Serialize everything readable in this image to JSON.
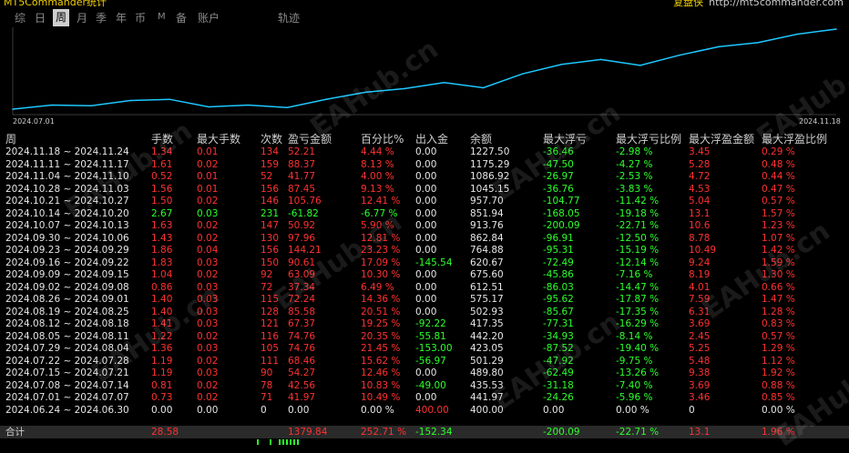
{
  "window": {
    "title": "MT5Commander统计",
    "brand_name": "复盘侠",
    "brand_url": "http://mt5commander.com"
  },
  "tabs": [
    {
      "label": "综",
      "active": false
    },
    {
      "label": "日",
      "active": false
    },
    {
      "label": "周",
      "active": true
    },
    {
      "label": "月",
      "active": false
    },
    {
      "label": "季",
      "active": false
    },
    {
      "label": "年",
      "active": false
    },
    {
      "label": "币",
      "active": false
    },
    {
      "label": "M",
      "active": false
    },
    {
      "label": "备",
      "active": false
    },
    {
      "label": "账户",
      "active": false
    },
    {
      "label": "轨迹",
      "active": false
    }
  ],
  "chart_data": {
    "type": "line",
    "x_start": "2024.07.01",
    "x_end": "2024.11.18",
    "series": [
      {
        "values": [
          400,
          441.97,
          435.53,
          489.8,
          501.29,
          423.05,
          442.2,
          417.35,
          502.93,
          575.17,
          612.51,
          675.6,
          620.67,
          764.88,
          862.84,
          913.76,
          851.94,
          957.7,
          1045.15,
          1086.92,
          1175.29,
          1227.5
        ]
      }
    ],
    "color": "#1ec8ff",
    "grid": false
  },
  "table": {
    "headers": [
      "周",
      "手数",
      "最大手数",
      "次数",
      "盈亏金额",
      "百分比%",
      "出入金",
      "余额",
      "最大浮亏",
      "最大浮亏比例",
      "最大浮盈金额",
      "最大浮盈比例"
    ],
    "rows": [
      [
        "2024.11.18 ~ 2024.11.24",
        "1.34",
        "0.01",
        "134",
        "52.21",
        "4.44 %",
        "0.00",
        "1227.50",
        "-36.46",
        "-2.98 %",
        "3.45",
        "0.29 %"
      ],
      [
        "2024.11.11 ~ 2024.11.17",
        "1.61",
        "0.02",
        "159",
        "88.37",
        "8.13 %",
        "0.00",
        "1175.29",
        "-47.50",
        "-4.27 %",
        "5.28",
        "0.48 %"
      ],
      [
        "2024.11.04 ~ 2024.11.10",
        "0.52",
        "0.01",
        "52",
        "41.77",
        "4.00 %",
        "0.00",
        "1086.92",
        "-26.97",
        "-2.53 %",
        "4.72",
        "0.44 %"
      ],
      [
        "2024.10.28 ~ 2024.11.03",
        "1.56",
        "0.01",
        "156",
        "87.45",
        "9.13 %",
        "0.00",
        "1045.15",
        "-36.76",
        "-3.83 %",
        "4.53",
        "0.47 %"
      ],
      [
        "2024.10.21 ~ 2024.10.27",
        "1.50",
        "0.02",
        "146",
        "105.76",
        "12.41 %",
        "0.00",
        "957.70",
        "-104.77",
        "-11.42 %",
        "5.04",
        "0.57 %"
      ],
      [
        "2024.10.14 ~ 2024.10.20",
        "2.67",
        "0.03",
        "231",
        "-61.82",
        "-6.77 %",
        "0.00",
        "851.94",
        "-168.05",
        "-19.18 %",
        "13.1",
        "1.57 %"
      ],
      [
        "2024.10.07 ~ 2024.10.13",
        "1.63",
        "0.02",
        "147",
        "50.92",
        "5.90 %",
        "0.00",
        "913.76",
        "-200.09",
        "-22.71 %",
        "10.6",
        "1.23 %"
      ],
      [
        "2024.09.30 ~ 2024.10.06",
        "1.43",
        "0.02",
        "130",
        "97.96",
        "12.81 %",
        "0.00",
        "862.84",
        "-96.91",
        "-12.50 %",
        "8.78",
        "1.07 %"
      ],
      [
        "2024.09.23 ~ 2024.09.29",
        "1.86",
        "0.04",
        "156",
        "144.21",
        "23.23 %",
        "0.00",
        "764.88",
        "-95.31",
        "-15.19 %",
        "10.49",
        "1.42 %"
      ],
      [
        "2024.09.16 ~ 2024.09.22",
        "1.83",
        "0.03",
        "150",
        "90.61",
        "17.09 %",
        "-145.54",
        "620.67",
        "-72.49",
        "-12.14 %",
        "9.24",
        "1.59 %"
      ],
      [
        "2024.09.09 ~ 2024.09.15",
        "1.04",
        "0.02",
        "92",
        "63.09",
        "10.30 %",
        "0.00",
        "675.60",
        "-45.86",
        "-7.16 %",
        "8.19",
        "1.30 %"
      ],
      [
        "2024.09.02 ~ 2024.09.08",
        "0.86",
        "0.03",
        "72",
        "37.34",
        "6.49 %",
        "0.00",
        "612.51",
        "-86.03",
        "-14.47 %",
        "4.01",
        "0.66 %"
      ],
      [
        "2024.08.26 ~ 2024.09.01",
        "1.40",
        "0.03",
        "115",
        "72.24",
        "14.36 %",
        "0.00",
        "575.17",
        "-95.62",
        "-17.87 %",
        "7.59",
        "1.47 %"
      ],
      [
        "2024.08.19 ~ 2024.08.25",
        "1.40",
        "0.03",
        "128",
        "85.58",
        "20.51 %",
        "0.00",
        "502.93",
        "-85.67",
        "-17.35 %",
        "6.31",
        "1.28 %"
      ],
      [
        "2024.08.12 ~ 2024.08.18",
        "1.41",
        "0.03",
        "121",
        "67.37",
        "19.25 %",
        "-92.22",
        "417.35",
        "-77.31",
        "-16.29 %",
        "3.69",
        "0.83 %"
      ],
      [
        "2024.08.05 ~ 2024.08.11",
        "1.22",
        "0.02",
        "116",
        "74.76",
        "20.35 %",
        "-55.81",
        "442.20",
        "-34.93",
        "-8.14 %",
        "2.45",
        "0.57 %"
      ],
      [
        "2024.07.29 ~ 2024.08.04",
        "1.36",
        "0.03",
        "105",
        "74.76",
        "21.45 %",
        "-153.00",
        "423.05",
        "-87.52",
        "-19.40 %",
        "5.25",
        "1.29 %"
      ],
      [
        "2024.07.22 ~ 2024.07.28",
        "1.19",
        "0.02",
        "111",
        "68.46",
        "15.62 %",
        "-56.97",
        "501.29",
        "-47.92",
        "-9.75 %",
        "5.48",
        "1.12 %"
      ],
      [
        "2024.07.15 ~ 2024.07.21",
        "1.19",
        "0.03",
        "90",
        "54.27",
        "12.46 %",
        "0.00",
        "489.80",
        "-62.49",
        "-13.26 %",
        "9.38",
        "1.92 %"
      ],
      [
        "2024.07.08 ~ 2024.07.14",
        "0.81",
        "0.02",
        "78",
        "42.56",
        "10.83 %",
        "-49.00",
        "435.53",
        "-31.18",
        "-7.40 %",
        "3.69",
        "0.88 %"
      ],
      [
        "2024.07.01 ~ 2024.07.07",
        "0.73",
        "0.02",
        "71",
        "41.97",
        "10.49 %",
        "0.00",
        "441.97",
        "-24.26",
        "-5.96 %",
        "3.46",
        "0.85 %"
      ],
      [
        "2024.06.24 ~ 2024.06.30",
        "0.00",
        "0.00",
        "0",
        "0.00",
        "0.00 %",
        "400.00",
        "400.00",
        "0.00",
        "0.00 %",
        "0",
        "0.00 %"
      ]
    ],
    "total": {
      "label": "合计",
      "lots": "28.58",
      "pnl": "1379.84",
      "percent": "252.71 %",
      "cashflow": "-152.34",
      "max_float_loss": "-200.09",
      "max_float_loss_pct": "-22.71 %",
      "max_float_profit": "13.1",
      "max_float_profit_pct": "1.96 %"
    }
  },
  "watermark": "EAHub.cn",
  "colors": {
    "profit": "#ff3131",
    "loss": "#2cff2c",
    "line": "#1ec8ff"
  }
}
